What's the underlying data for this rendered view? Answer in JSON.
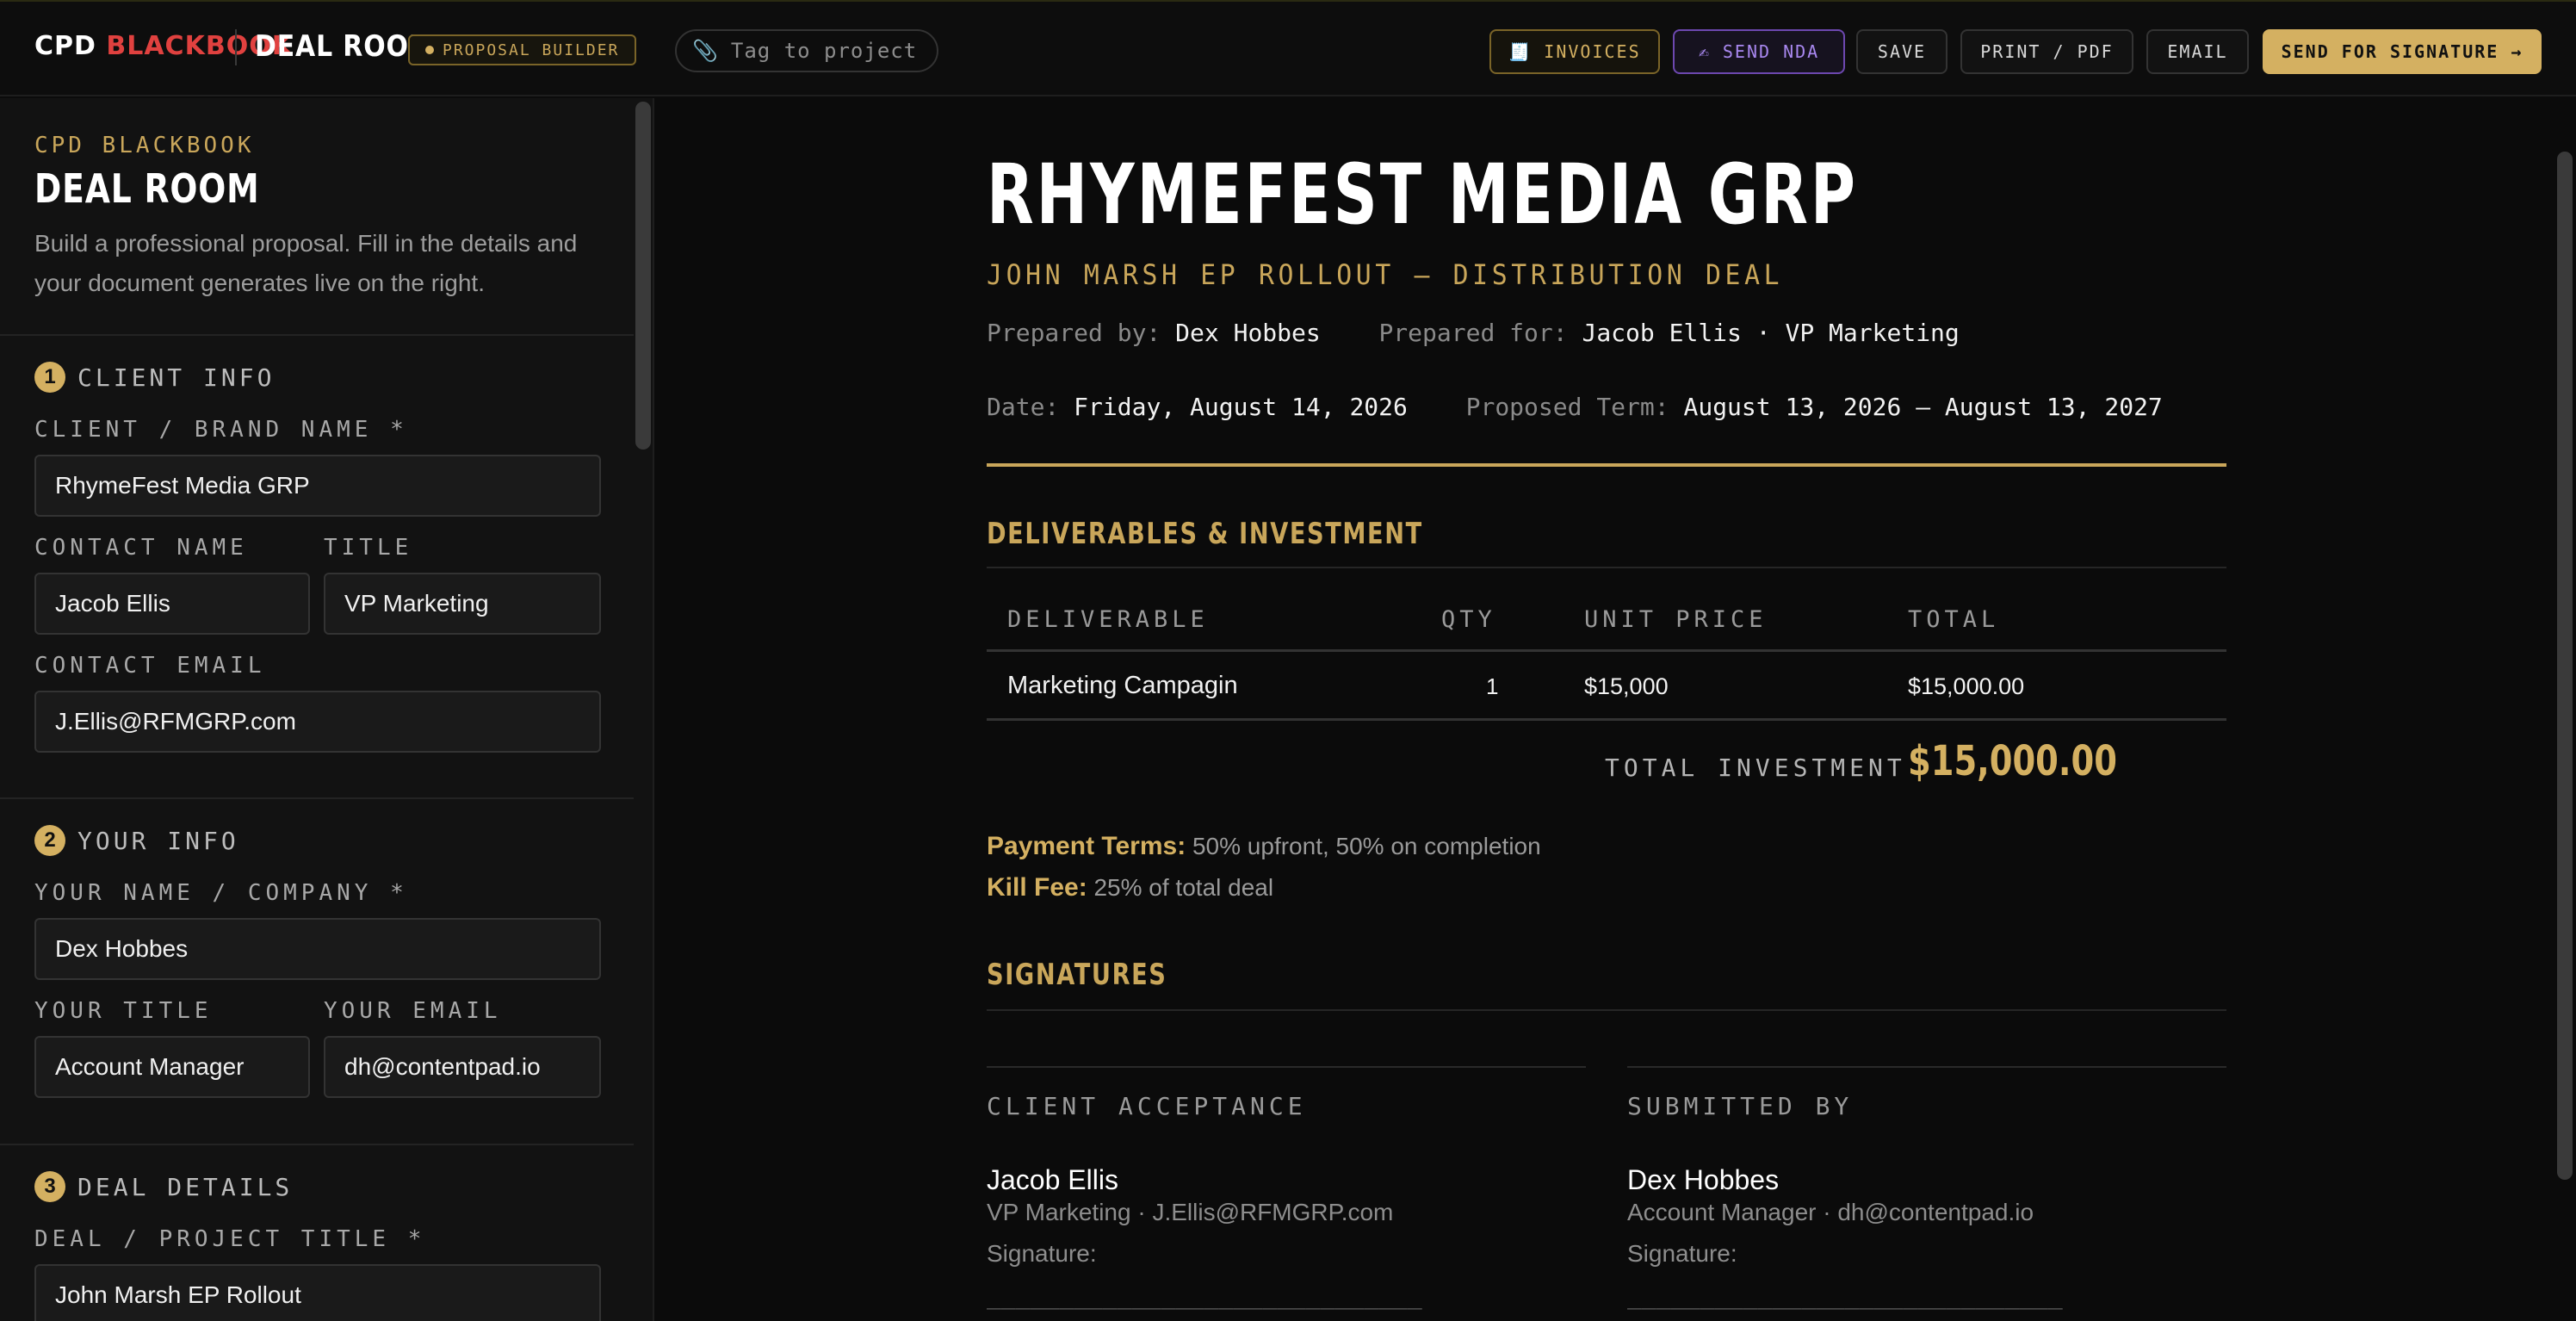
{
  "topbar": {
    "brand_white": "CPD",
    "brand_red": "BLACKBOOK",
    "room": "DEAL ROOM",
    "badge": "PROPOSAL BUILDER",
    "tag_placeholder": "Tag to project",
    "buttons": {
      "invoices": "INVOICES",
      "send_nda": "SEND NDA",
      "save": "SAVE",
      "print": "PRINT / PDF",
      "email": "EMAIL",
      "send_signature": "SEND FOR SIGNATURE →"
    },
    "icons": {
      "invoices": "🧾",
      "nda": "✍",
      "tag": "📎"
    }
  },
  "sidebar": {
    "kicker": "CPD BLACKBOOK",
    "title": "DEAL ROOM",
    "description": "Build a professional proposal. Fill in the details and your document generates live on the right.",
    "sections": [
      {
        "num": "1",
        "title": "CLIENT INFO"
      },
      {
        "num": "2",
        "title": "YOUR INFO"
      },
      {
        "num": "3",
        "title": "DEAL DETAILS"
      }
    ],
    "client": {
      "brand_label": "CLIENT / BRAND NAME *",
      "brand_value": "RhymeFest Media GRP",
      "contact_label": "CONTACT NAME",
      "contact_value": "Jacob Ellis",
      "title_label": "TITLE",
      "title_value": "VP Marketing",
      "email_label": "CONTACT EMAIL",
      "email_value": "J.Ellis@RFMGRP.com"
    },
    "you": {
      "name_label": "YOUR NAME / COMPANY *",
      "name_value": "Dex Hobbes",
      "title_label": "YOUR TITLE",
      "title_value": "Account Manager",
      "email_label": "YOUR EMAIL",
      "email_value": "dh@contentpad.io"
    },
    "deal": {
      "title_label": "DEAL / PROJECT TITLE *",
      "title_value": "John Marsh EP Rollout"
    }
  },
  "document": {
    "title": "RHYMEFEST MEDIA GRP",
    "subtitle": "JOHN MARSH EP ROLLOUT — DISTRIBUTION DEAL",
    "prepared_by_label": "Prepared by:",
    "prepared_by": "Dex Hobbes",
    "prepared_for_label": "Prepared for:",
    "prepared_for": "Jacob Ellis · VP Marketing",
    "date_label": "Date:",
    "date": "Friday, August 14, 2026",
    "term_label": "Proposed Term:",
    "term": "August 13, 2026 — August 13, 2027",
    "deliverables_heading": "DELIVERABLES & INVESTMENT",
    "table": {
      "headers": [
        "DELIVERABLE",
        "QTY",
        "UNIT PRICE",
        "TOTAL"
      ],
      "rows": [
        {
          "deliverable": "Marketing Campagin",
          "qty": "1",
          "unit_price": "$15,000",
          "total": "$15,000.00"
        }
      ]
    },
    "total_label": "TOTAL INVESTMENT",
    "total_value": "$15,000.00",
    "payment_terms_label": "Payment Terms:",
    "payment_terms": "50% upfront, 50% on completion",
    "kill_fee_label": "Kill Fee:",
    "kill_fee": "25% of total deal",
    "signatures_heading": "SIGNATURES",
    "client_sig": {
      "heading": "CLIENT ACCEPTANCE",
      "name": "Jacob Ellis",
      "sub": "VP Marketing · J.Ellis@RFMGRP.com",
      "sig_label": "Signature:",
      "line": "______________________________"
    },
    "submitter_sig": {
      "heading": "SUBMITTED BY",
      "name": "Dex Hobbes",
      "sub": "Account Manager · dh@contentpad.io",
      "sig_label": "Signature:",
      "line": "______________________________"
    }
  },
  "colors": {
    "gold": "#d4b061",
    "red": "#e0413f",
    "purple": "#a988f0",
    "bg": "#0b0b0b"
  }
}
